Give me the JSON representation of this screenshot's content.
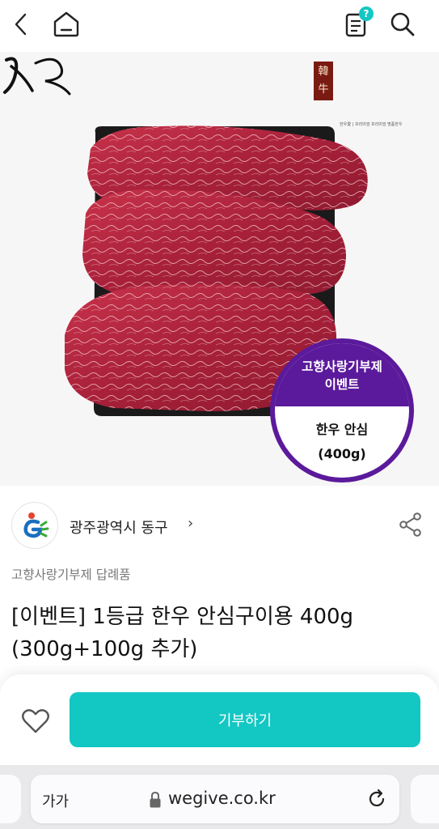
{
  "icons": {
    "back": "chevron-left-icon",
    "home": "home-icon",
    "orders": "receipt-icon",
    "help_badge": "question-badge-icon",
    "search": "search-icon",
    "share": "share-icon",
    "heart": "heart-icon",
    "lock": "lock-icon",
    "reload": "reload-icon"
  },
  "topbar": {
    "help_badge": "?"
  },
  "hero": {
    "brand_seal": "韓牛",
    "brand_caption": "한우愛 | 프리미엄 프리미엄 명품한우",
    "event": {
      "line1": "고향사랑기부제",
      "line2": "이벤트",
      "product": "한우 안심",
      "weight": "(400g)"
    },
    "carousel": {
      "count": 3,
      "active_index": 0
    }
  },
  "seller": {
    "name": "광주광역시 동구",
    "chevron": "›"
  },
  "product": {
    "category": "고향사랑기부제 답례품",
    "title": "[이벤트] 1등급 한우 안심구이용 400g (300g+100g 추가)"
  },
  "actions": {
    "donate_label": "기부하기"
  },
  "browser": {
    "text_size_label": "가가",
    "url": "wegive.co.kr"
  },
  "colors": {
    "accent": "#13c7c3",
    "event_purple": "#5b1a9b",
    "meat": "#b0283a"
  }
}
